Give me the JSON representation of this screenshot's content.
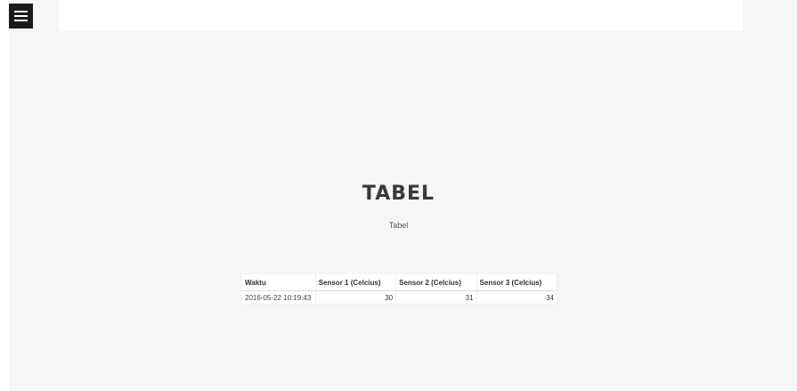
{
  "header": {
    "menu_icon": "hamburger-icon"
  },
  "section": {
    "title": "TABEL",
    "subtitle": "Tabel"
  },
  "table": {
    "columns": [
      "Waktu",
      "Sensor 1 (Celcius)",
      "Sensor 2 (Celcius)",
      "Sensor 3 (Celcius)"
    ],
    "rows": [
      [
        "2016-05-22 10:19:43",
        "30",
        "31",
        "34"
      ]
    ]
  },
  "colors": {
    "background": "#f6f6f6",
    "menu_button": "#1a1a1a",
    "title": "#3a3a3a"
  }
}
